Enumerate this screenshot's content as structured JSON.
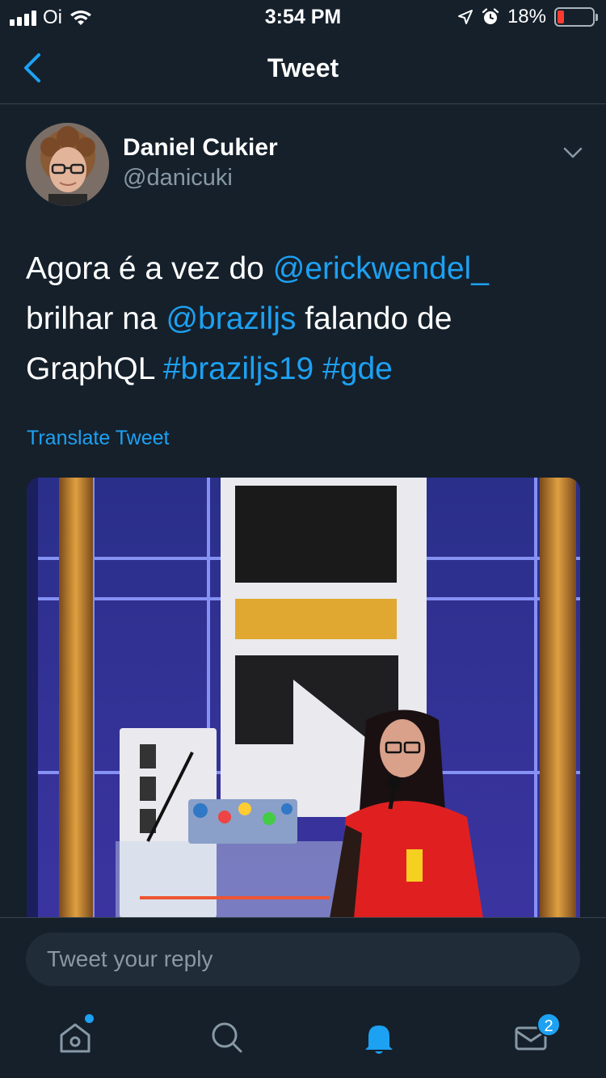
{
  "status_bar": {
    "carrier": "Oi",
    "time": "3:54 PM",
    "battery_percent": "18%",
    "battery_level": 0.18,
    "icons": [
      "signal-icon",
      "wifi-icon",
      "location-icon",
      "alarm-icon",
      "battery-icon"
    ]
  },
  "nav": {
    "title": "Tweet",
    "back_icon": "chevron-left-icon"
  },
  "tweet": {
    "author_name": "Daniel Cukier",
    "author_handle": "@danicuki",
    "text_parts": {
      "p1": "Agora é a vez do ",
      "mention1": "@erickwendel_",
      "p2": "brilhar na ",
      "mention2": "@braziljs",
      "p3": " falando de",
      "p4": "GraphQL ",
      "hashtag1": "#braziljs19",
      "hashtag2": "#gde"
    },
    "translate_label": "Translate Tweet"
  },
  "reply": {
    "placeholder": "Tweet your reply"
  },
  "tab_bar": {
    "tabs": [
      {
        "name": "home",
        "icon": "home-icon",
        "has_dot": true
      },
      {
        "name": "search",
        "icon": "search-icon"
      },
      {
        "name": "notifications",
        "icon": "bell-icon",
        "active": true
      },
      {
        "name": "messages",
        "icon": "mail-icon",
        "badge": "2"
      }
    ]
  },
  "colors": {
    "background": "#15202b",
    "accent": "#1da1f2",
    "secondary_text": "#8899a6",
    "divider": "#38444d"
  }
}
